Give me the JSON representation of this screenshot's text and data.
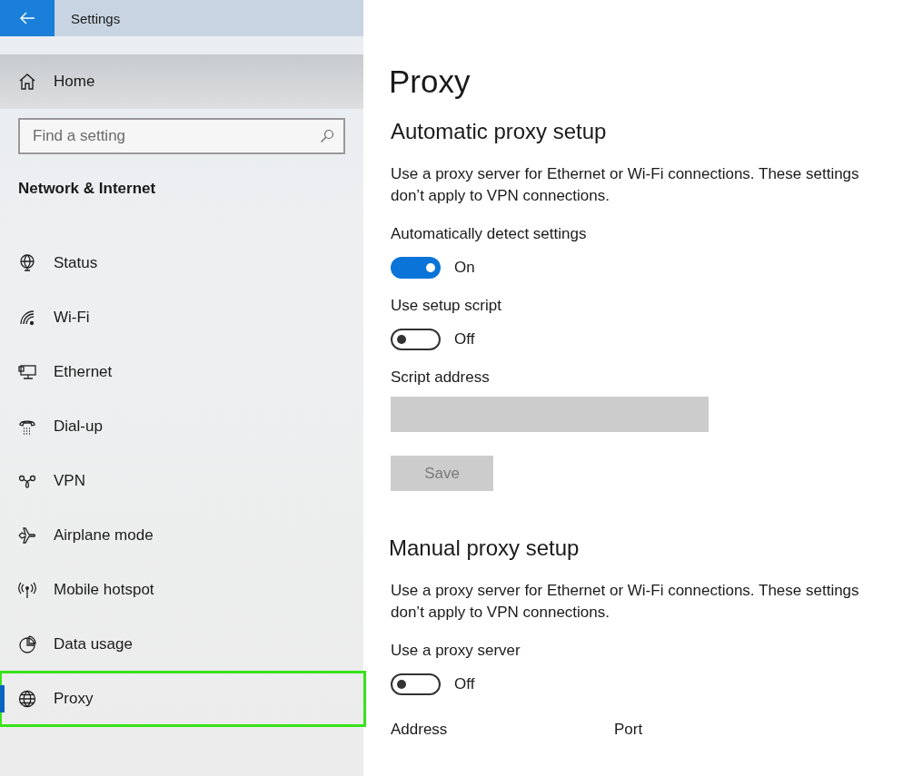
{
  "window": {
    "title": "Settings"
  },
  "sidebar": {
    "home": "Home",
    "search": {
      "placeholder": "Find a setting"
    },
    "section": "Network & Internet",
    "items": [
      {
        "label": "Status",
        "selected": false,
        "highlighted": false
      },
      {
        "label": "Wi-Fi",
        "selected": false,
        "highlighted": false
      },
      {
        "label": "Ethernet",
        "selected": false,
        "highlighted": false
      },
      {
        "label": "Dial-up",
        "selected": false,
        "highlighted": false
      },
      {
        "label": "VPN",
        "selected": false,
        "highlighted": false
      },
      {
        "label": "Airplane mode",
        "selected": false,
        "highlighted": false
      },
      {
        "label": "Mobile hotspot",
        "selected": false,
        "highlighted": false
      },
      {
        "label": "Data usage",
        "selected": false,
        "highlighted": false
      },
      {
        "label": "Proxy",
        "selected": true,
        "highlighted": true
      }
    ]
  },
  "page": {
    "title": "Proxy",
    "sections": [
      {
        "heading": "Automatic proxy setup",
        "description": "Use a proxy server for Ethernet or Wi-Fi connections. These settings don’t apply to VPN connections.",
        "controls": [
          {
            "kind": "toggle",
            "label": "Automatically detect settings",
            "on": true,
            "state_text": "On"
          },
          {
            "kind": "toggle",
            "label": "Use setup script",
            "on": false,
            "state_text": "Off"
          },
          {
            "kind": "field",
            "label": "Script address",
            "disabled": true
          },
          {
            "kind": "button",
            "label": "Save",
            "disabled": true
          }
        ]
      },
      {
        "heading": "Manual proxy setup",
        "description": "Use a proxy server for Ethernet or Wi-Fi connections. These settings don’t apply to VPN connections.",
        "controls": [
          {
            "kind": "toggle",
            "label": "Use a proxy server",
            "on": false,
            "state_text": "Off"
          },
          {
            "kind": "labels",
            "labels": [
              "Address",
              "Port"
            ]
          }
        ]
      }
    ]
  }
}
